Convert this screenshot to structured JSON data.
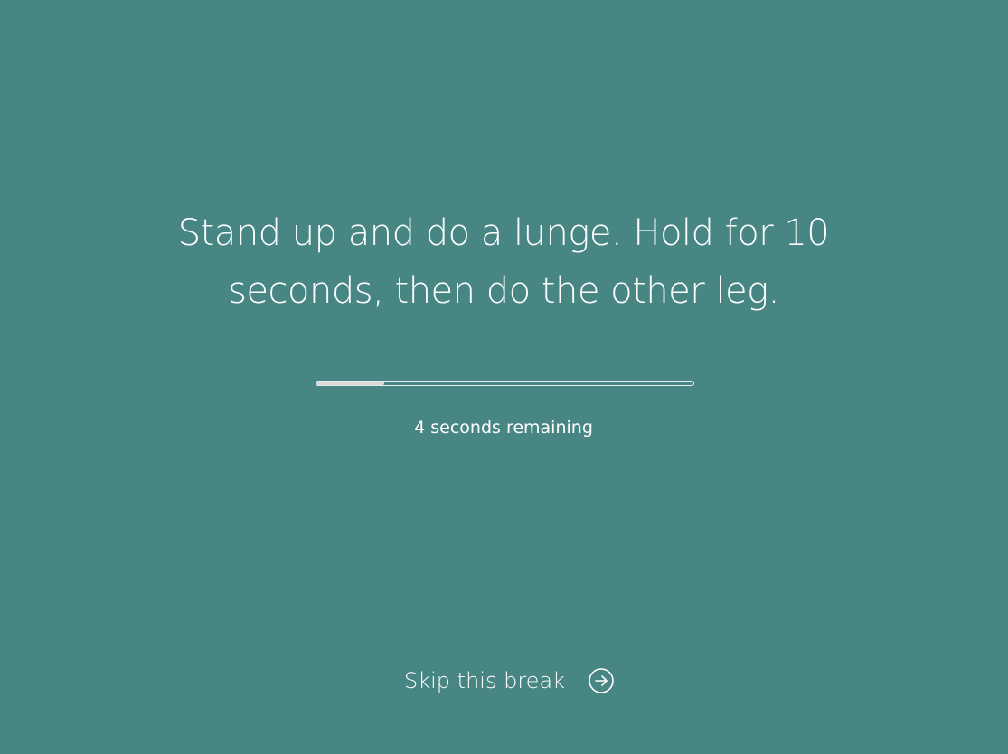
{
  "break": {
    "message": "Stand up and do a lunge. Hold for 10 seconds, then do the other leg.",
    "progress_fraction": 0.18,
    "remaining_text": "4 seconds remaining"
  },
  "skip": {
    "label": "Skip this break",
    "icon": "arrow-right-circle-icon"
  },
  "colors": {
    "background": "#488684",
    "text": "#ffffff",
    "progress_fill": "#d9d9d9"
  }
}
